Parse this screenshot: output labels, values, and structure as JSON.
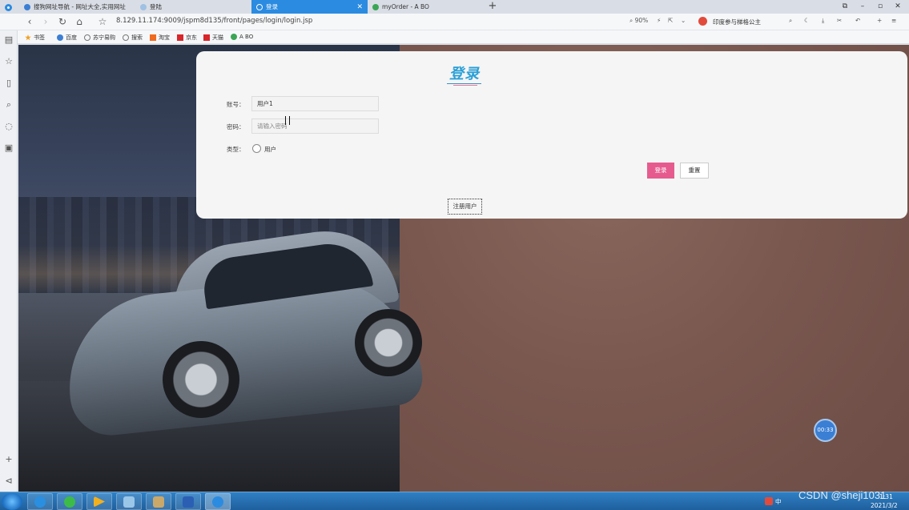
{
  "browser": {
    "tabs": [
      {
        "label": "搜狗网址导航 - 网址大全,实用网址",
        "favicon_color": "#3b7fd4"
      },
      {
        "label": "登陆",
        "favicon_color": "#6fa8dc"
      },
      {
        "label": "登录",
        "favicon_color": "#ffffff"
      },
      {
        "label": "myOrder - A BO",
        "favicon_color": "#3aa655"
      }
    ],
    "new_tab": "+",
    "window_controls": [
      "⧉",
      "–",
      "▫",
      "✕"
    ],
    "url": "8.129.11.174:9009/jspm8d135/front/pages/login/login.jsp",
    "zoom": "90%",
    "search_hint": "印度参与梯格公主"
  },
  "bookmarks": [
    {
      "label": "书签",
      "color": "#f0a020"
    },
    {
      "label": "百度",
      "color": "#3b7fd4"
    },
    {
      "label": "苏宁易购",
      "color": "#777777"
    },
    {
      "label": "搜索",
      "color": "#777777"
    },
    {
      "label": "淘宝",
      "color": "#ef6b1f"
    },
    {
      "label": "京东",
      "color": "#d8262b"
    },
    {
      "label": "天猫",
      "color": "#d8262b"
    },
    {
      "label": "A BO",
      "color": "#3aa655"
    }
  ],
  "login": {
    "title": "登录",
    "account_label": "账号：",
    "account_value": "用户1",
    "password_label": "密码：",
    "password_placeholder": "请输入密码",
    "type_label": "类型：",
    "type_option": "用户",
    "login_button": "登录",
    "reset_button": "重置",
    "register_link": "注册用户"
  },
  "timer": "00:33",
  "taskbar": {
    "ime": "中",
    "time": "1:31",
    "date": "2021/3/2"
  },
  "watermark": "CSDN @sheji1031",
  "colors": {
    "accent": "#2b8be0",
    "login_button": "#e65b8e",
    "title": "#2a9fd6"
  }
}
